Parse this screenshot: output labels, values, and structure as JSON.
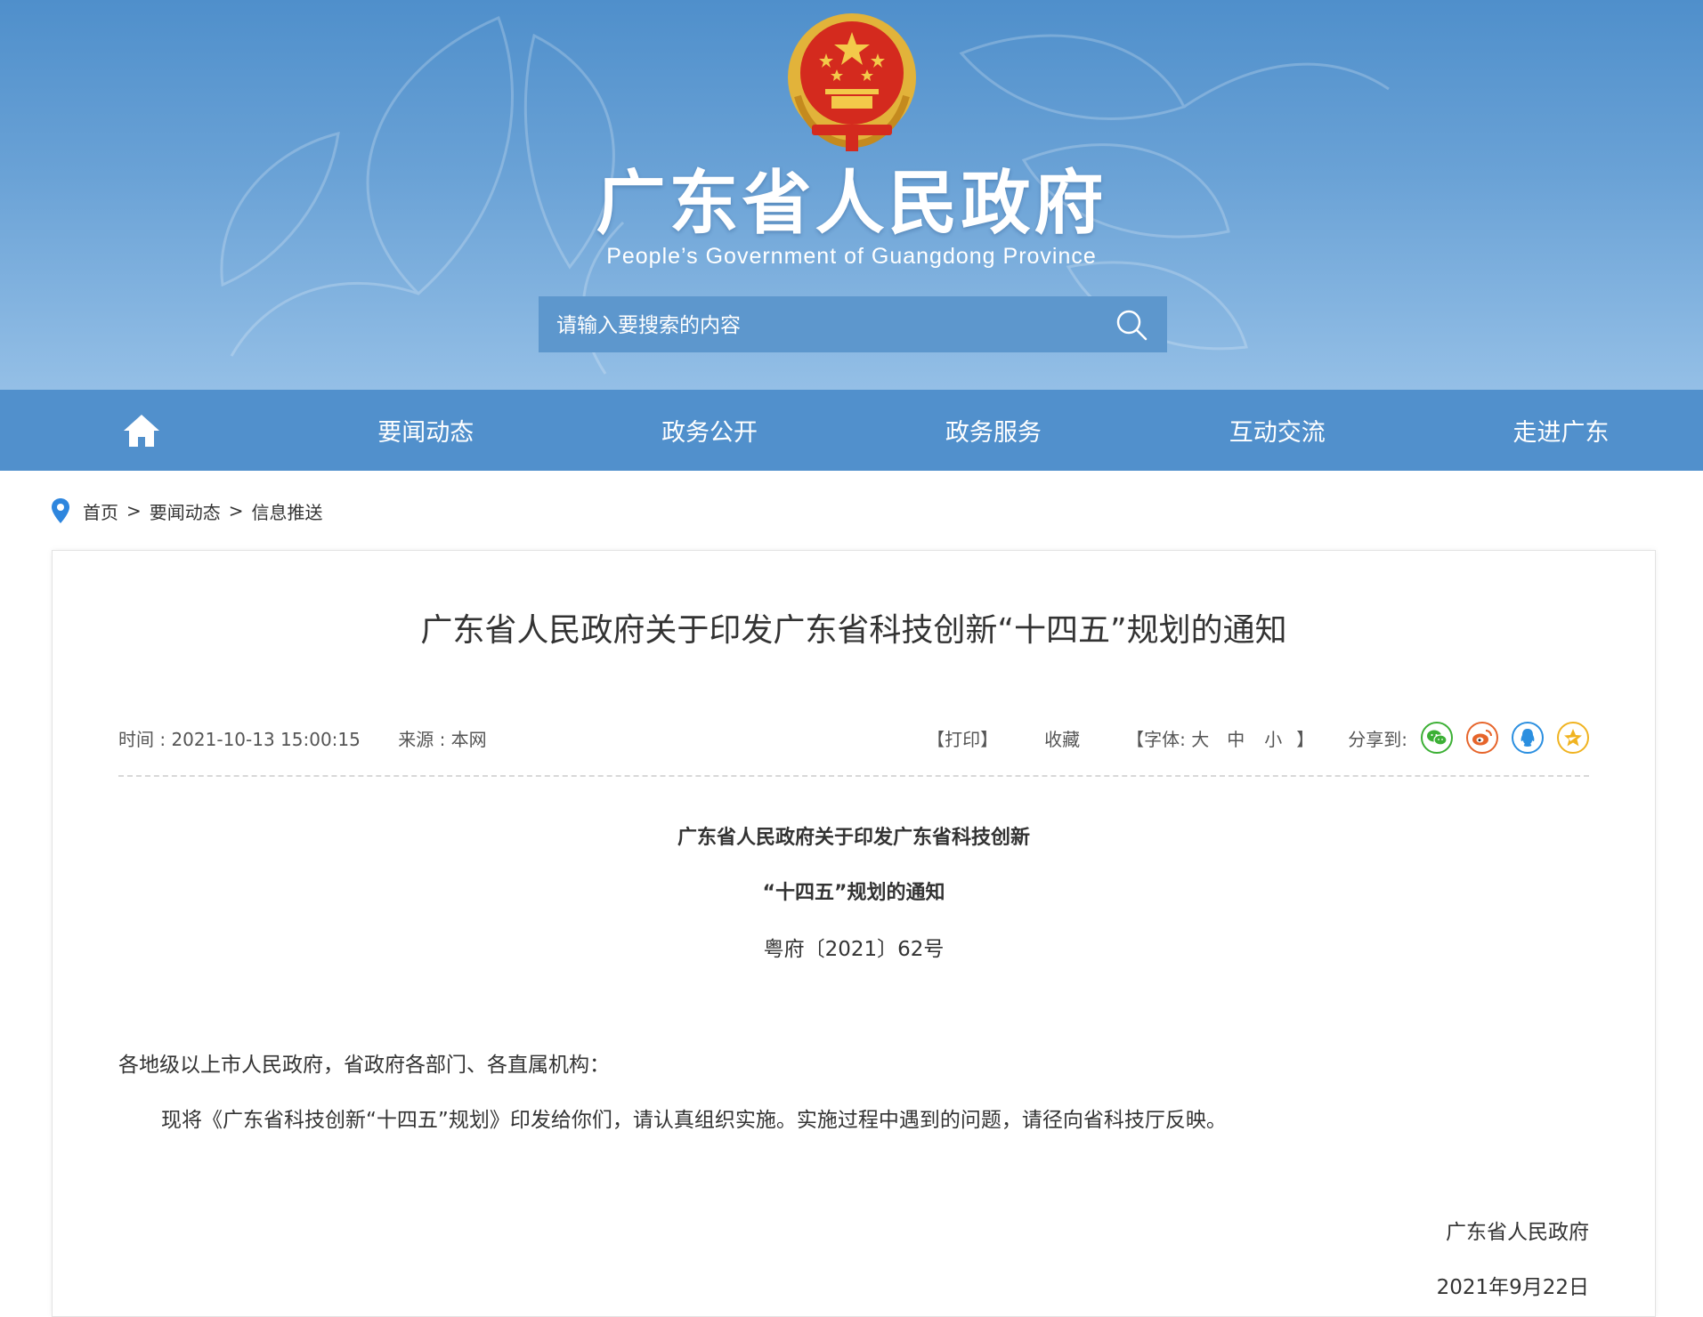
{
  "header": {
    "title": "广东省人民政府",
    "subtitle": "People’s Government of Guangdong Province",
    "search_placeholder": "请输入要搜索的内容",
    "emblem_icon": "national-emblem-icon"
  },
  "nav": {
    "home_icon": "home-icon",
    "items": [
      {
        "label": "要闻动态"
      },
      {
        "label": "政务公开"
      },
      {
        "label": "政务服务"
      },
      {
        "label": "互动交流"
      },
      {
        "label": "走进广东"
      }
    ]
  },
  "breadcrumb": {
    "icon": "location-pin-icon",
    "items": [
      {
        "label": "首页"
      },
      {
        "label": "要闻动态"
      },
      {
        "label": "信息推送"
      }
    ],
    "separator": ">"
  },
  "article": {
    "title": "广东省人民政府关于印发广东省科技创新“十四五”规划的通知",
    "meta": {
      "time": "时间 : 2021-10-13 15:00:15",
      "source": "来源 : 本网",
      "print": "【打印】",
      "favorite": "收藏",
      "font_prefix": "【字体: 大",
      "font_medium": "中",
      "font_small": "小",
      "font_suffix": "】",
      "share_label": "分享到:"
    },
    "share_icons": [
      {
        "name": "wechat-icon",
        "color": "#3cb035"
      },
      {
        "name": "weibo-icon",
        "color": "#e6642a"
      },
      {
        "name": "qq-icon",
        "color": "#2b8fe0"
      },
      {
        "name": "qzone-icon",
        "color": "#f0b320"
      }
    ],
    "doc_title_line1": "广东省人民政府关于印发广东省科技创新",
    "doc_title_line2": "“十四五”规划的通知",
    "doc_number": "粤府〔2021〕62号",
    "salutation": "各地级以上市人民政府，省政府各部门、各直属机构：",
    "body": "现将《广东省科技创新“十四五”规划》印发给你们，请认真组织实施。实施过程中遇到的问题，请径向省科技厅反映。",
    "sign_org": "广东省人民政府",
    "sign_date": "2021年9月22日"
  },
  "colors": {
    "nav_bg": "#5190cc",
    "header_top": "#4f8fcb",
    "header_bottom": "#94bfe6",
    "search_bg": "#5d97cd"
  }
}
